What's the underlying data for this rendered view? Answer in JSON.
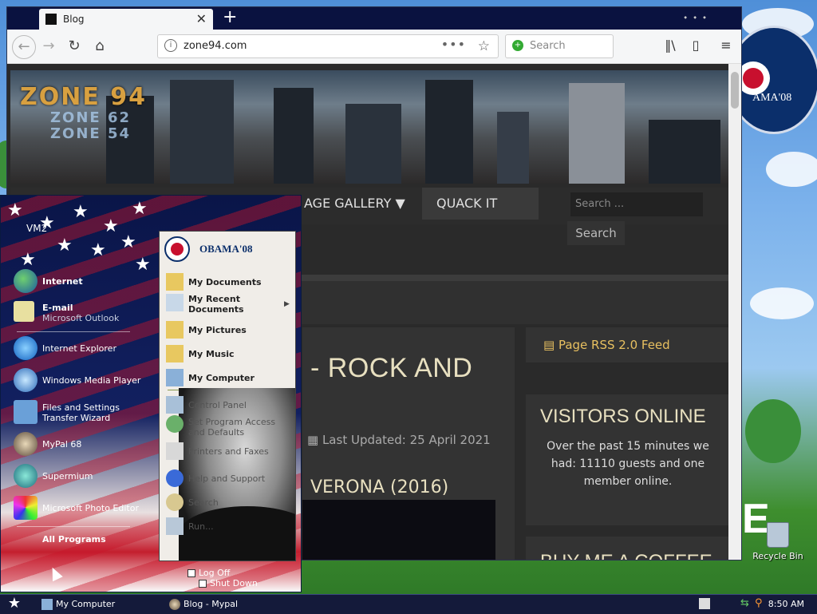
{
  "browser": {
    "tab_title": "Blog",
    "url": "zone94.com",
    "search_placeholder": "Search",
    "new_tab": "+"
  },
  "site": {
    "logo_main": "ZONE 94",
    "logo_sub1": "ZONE 62",
    "logo_sub2": "ZONE 54",
    "menu": [
      "AGE GALLERY",
      "QUACK IT"
    ],
    "search_placeholder": "Search ...",
    "search_button": "Search",
    "article_title": "- ROCK AND",
    "last_updated": "Last Updated: 25 April 2021",
    "article_sub": "VERONA (2016)",
    "rss": "Page RSS 2.0 Feed",
    "visitors_title": "VISITORS ONLINE",
    "visitors_text": "Over the past 15 minutes we had: 11110 guests and one member online.",
    "coffee_title": "BUY ME A COFFEE"
  },
  "desktop": {
    "badge_text": "AMA'08",
    "recycle_label": "Recycle Bin"
  },
  "startmenu": {
    "user": "VM2",
    "pinned": [
      {
        "label": "Internet",
        "sub": ""
      },
      {
        "label": "E-mail",
        "sub": "Microsoft Outlook"
      }
    ],
    "recent": [
      "Internet Explorer",
      "Windows Media Player",
      "Files and Settings Transfer Wizard",
      "MyPal 68",
      "Supermium",
      "Microsoft Photo Editor"
    ],
    "all_programs": "All Programs",
    "right_header": "OBAMA'08",
    "right_items": [
      "My Documents",
      "My Recent Documents",
      "My Pictures",
      "My Music",
      "My Computer",
      "Control Panel",
      "Set Program Access and Defaults",
      "Printers and Faxes",
      "Help and Support",
      "Search",
      "Run..."
    ],
    "log_off": "Log Off",
    "shut_down": "Shut Down"
  },
  "taskbar": {
    "items": [
      "My Computer",
      "Blog - Mypal"
    ],
    "clock": "8:50 AM"
  },
  "colors": {
    "taskbar": "#141a3a",
    "site_accent": "#e8c060",
    "flag_red": "#c8102e",
    "flag_blue": "#0b2f6b"
  }
}
